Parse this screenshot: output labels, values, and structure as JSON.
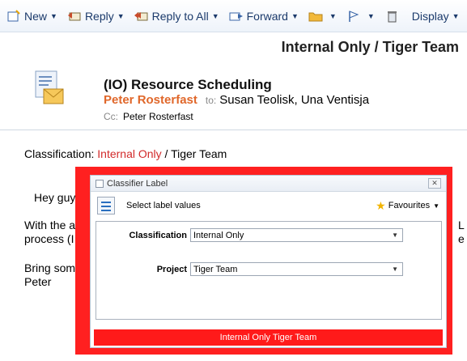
{
  "toolbar": {
    "new_label": "New",
    "reply_label": "Reply",
    "reply_all_label": "Reply to All",
    "forward_label": "Forward",
    "display_label": "Display"
  },
  "message": {
    "banner": "Internal Only / Tiger Team",
    "subject": "(IO) Resource Scheduling",
    "from": "Peter Rosterfast",
    "to_label": "to:",
    "to": "Susan Teolisk, Una Ventisja",
    "cc_label": "Cc:",
    "cc": "Peter Rosterfast"
  },
  "body": {
    "classification_prefix": "Classification: ",
    "classification_value": "Internal Only",
    "classification_sep": " / ",
    "classification_project": "Tiger Team",
    "greeting": "Hey guy",
    "line1": "With the a",
    "line2": "process (I",
    "line3": "Bring som",
    "signature": "Peter",
    "right_frag1": "L",
    "right_frag2": "e"
  },
  "dialog": {
    "title": "Classifier Label",
    "close_glyph": "✕",
    "header_text": "Select label values",
    "favourites_label": "Favourites",
    "classification_label": "Classification",
    "classification_value": "Internal Only",
    "project_label": "Project",
    "project_value": "Tiger Team",
    "result_bar": "Internal Only Tiger Team"
  },
  "colors": {
    "from": "#e0672a",
    "classification_red": "#d22a2a",
    "dialog_frame": "#ff2020",
    "result_bar": "#ff1a1a"
  }
}
